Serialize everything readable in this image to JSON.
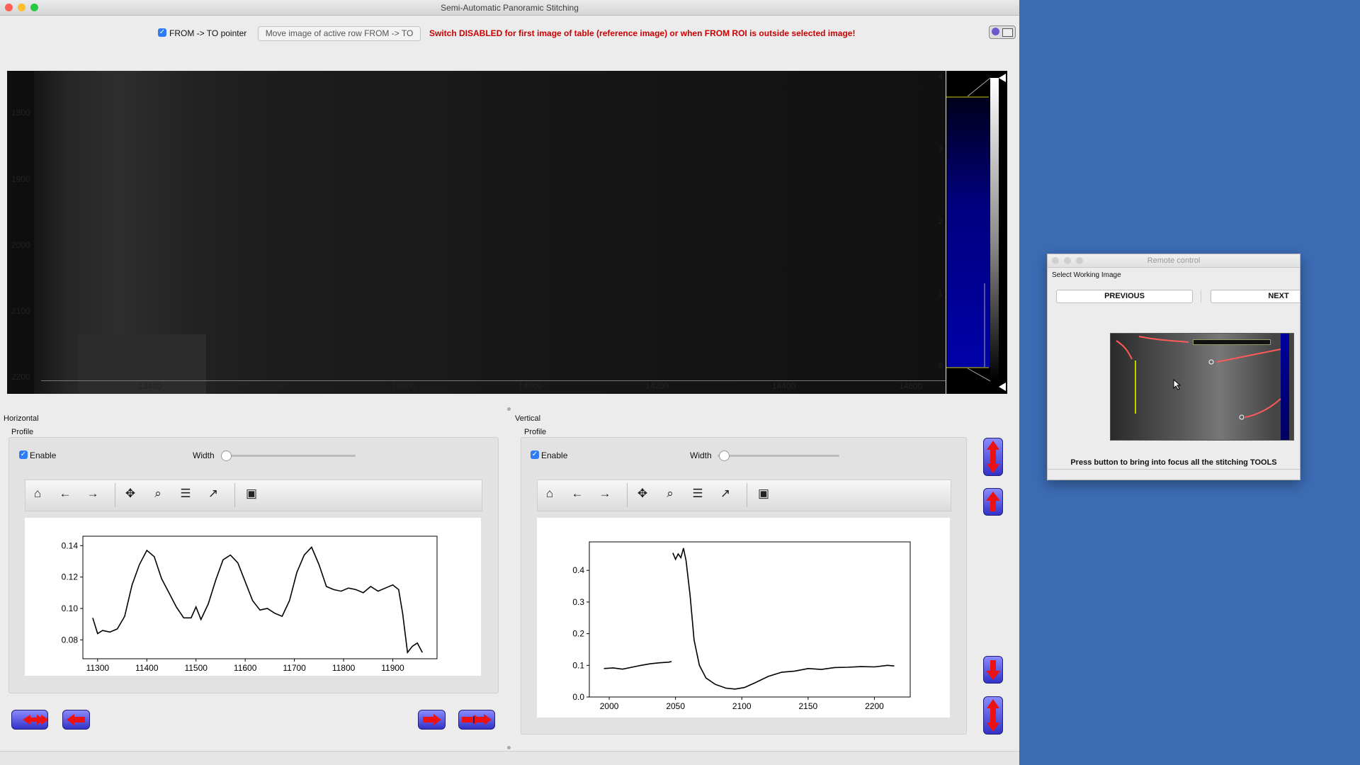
{
  "main_window": {
    "title": "Semi-Automatic Panoramic Stitching",
    "from_to_checkbox": {
      "label": "FROM -> TO pointer",
      "checked": true
    },
    "move_button_label": "Move image of active row FROM -> TO",
    "switch_warning": "Switch DISABLED for first image of table (reference image) or when FROM ROI is outside selected image!",
    "image_view": {
      "y_ticks": [
        "1800",
        "1900",
        "2000",
        "2100",
        "2200"
      ],
      "x_ticks": [
        "13400",
        "13600",
        "13800",
        "14000",
        "14200",
        "14400",
        "14600"
      ],
      "colorbar_ticks": [
        "4",
        "3",
        "2",
        "1",
        "0"
      ]
    },
    "horizontal": {
      "group_label": "Horizontal",
      "profile_label": "Profile",
      "enable_label": "Enable",
      "enable_checked": true,
      "width_label": "Width"
    },
    "vertical": {
      "group_label": "Vertical",
      "profile_label": "Profile",
      "enable_label": "Enable",
      "enable_checked": true,
      "width_label": "Width"
    },
    "toolbar_icons": [
      "home-icon",
      "back-arrow-icon",
      "forward-arrow-icon",
      "pan-icon",
      "zoom-icon",
      "configure-icon",
      "edit-axis-icon",
      "save-icon"
    ]
  },
  "chart_data": [
    {
      "type": "line",
      "xlim": [
        11270,
        11990
      ],
      "ylim": [
        0.068,
        0.146
      ],
      "x_ticks": [
        11300,
        11400,
        11500,
        11600,
        11700,
        11800,
        11900
      ],
      "y_ticks": [
        0.08,
        0.1,
        0.12,
        0.14
      ],
      "tick_labels_x": [
        "11300",
        "11400",
        "11500",
        "11600",
        "11700",
        "11800",
        "11900"
      ],
      "tick_labels_y": [
        "0.08",
        "0.10",
        "0.12",
        "0.14"
      ],
      "series": [
        {
          "x": [
            11290,
            11300,
            11310,
            11325,
            11340,
            11355,
            11370,
            11385,
            11400,
            11415,
            11430,
            11445,
            11460,
            11475,
            11490,
            11500,
            11510,
            11525,
            11540,
            11555,
            11570,
            11585,
            11600,
            11615,
            11630,
            11645,
            11660,
            11675,
            11690,
            11705,
            11720,
            11735,
            11750,
            11765,
            11780,
            11795,
            11810,
            11825,
            11840,
            11855,
            11870,
            11885,
            11900,
            11912,
            11920,
            11930,
            11940,
            11950,
            11960
          ],
          "y": [
            0.094,
            0.084,
            0.086,
            0.085,
            0.087,
            0.095,
            0.115,
            0.128,
            0.137,
            0.133,
            0.119,
            0.11,
            0.101,
            0.094,
            0.094,
            0.101,
            0.093,
            0.103,
            0.118,
            0.131,
            0.134,
            0.129,
            0.117,
            0.105,
            0.099,
            0.1,
            0.097,
            0.095,
            0.105,
            0.123,
            0.134,
            0.139,
            0.128,
            0.114,
            0.112,
            0.111,
            0.113,
            0.112,
            0.11,
            0.114,
            0.111,
            0.113,
            0.115,
            0.112,
            0.097,
            0.072,
            0.076,
            0.078,
            0.072
          ]
        }
      ]
    },
    {
      "type": "line",
      "xlim": [
        1985,
        2227
      ],
      "ylim": [
        0.0,
        0.49
      ],
      "x_ticks": [
        2000,
        2050,
        2100,
        2150,
        2200
      ],
      "y_ticks": [
        0.0,
        0.1,
        0.2,
        0.3,
        0.4
      ],
      "tick_labels_x": [
        "2000",
        "2050",
        "2100",
        "2150",
        "2200"
      ],
      "tick_labels_y": [
        "0.0",
        "0.1",
        "0.2",
        "0.3",
        "0.4"
      ],
      "series": [
        {
          "x": [
            1996,
            2003,
            2010,
            2017,
            2024,
            2031,
            2038,
            2045,
            2047
          ],
          "y": [
            0.09,
            0.092,
            0.088,
            0.094,
            0.1,
            0.105,
            0.108,
            0.11,
            0.112
          ]
        },
        {
          "x": [
            2048,
            2050,
            2052,
            2054,
            2056,
            2058,
            2061,
            2064,
            2068,
            2073,
            2080,
            2088,
            2095,
            2102,
            2110,
            2120,
            2130,
            2140,
            2150,
            2160,
            2170,
            2180,
            2190,
            2200,
            2210,
            2215
          ],
          "y": [
            0.455,
            0.435,
            0.452,
            0.44,
            0.47,
            0.43,
            0.32,
            0.18,
            0.1,
            0.06,
            0.04,
            0.028,
            0.025,
            0.03,
            0.045,
            0.065,
            0.078,
            0.082,
            0.09,
            0.087,
            0.093,
            0.094,
            0.096,
            0.095,
            0.1,
            0.098
          ]
        }
      ]
    }
  ],
  "remote_control": {
    "title": "Remote control",
    "section_label": "Select Working Image",
    "previous_label": "PREVIOUS",
    "next_label": "NEXT",
    "instruction": "Press button to bring into focus all the stitching TOOLS"
  },
  "colors": {
    "accent_checkbox": "#2f7bf5",
    "warning_text": "#cc0000",
    "desktop": "#3c6cb4",
    "nav_button": "#3a3ad0",
    "nav_arrow": "#ee1111"
  }
}
